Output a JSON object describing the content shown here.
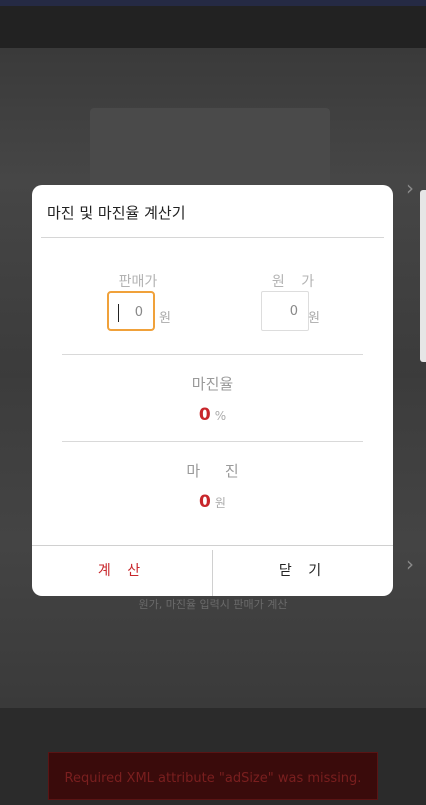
{
  "background": {
    "hint_text": "원가, 마진율 입력시 판매가 계산",
    "ad_error": "Required XML attribute \"adSize\" was missing."
  },
  "dialog": {
    "title": "마진 및 마진율 계산기",
    "sale_price": {
      "label": "판매가",
      "value": "0",
      "unit": "원"
    },
    "cost_price": {
      "label": "원 가",
      "value": "0",
      "unit": "원"
    },
    "margin_rate": {
      "label": "마진율",
      "value": "0",
      "unit": "%"
    },
    "margin": {
      "label": "마 진",
      "value": "0",
      "unit": "원"
    },
    "buttons": {
      "calculate": "계 산",
      "close": "닫 기"
    }
  },
  "colors": {
    "accent_red": "#c8262b",
    "focus_orange": "#f0a13a"
  }
}
